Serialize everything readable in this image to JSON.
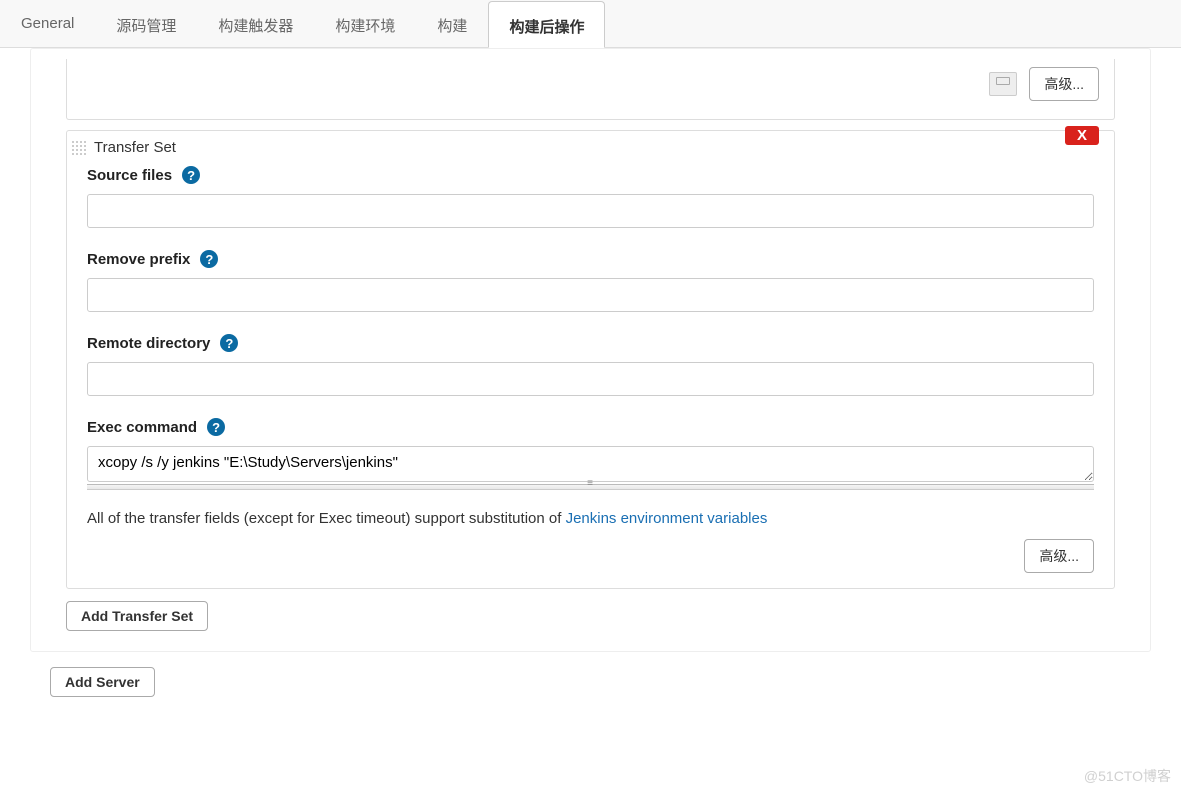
{
  "tabs": [
    {
      "label": "General"
    },
    {
      "label": "源码管理"
    },
    {
      "label": "构建触发器"
    },
    {
      "label": "构建环境"
    },
    {
      "label": "构建"
    },
    {
      "label": "构建后操作",
      "active": true
    }
  ],
  "top_remnant": {
    "button_label": "高级..."
  },
  "transfer_set": {
    "title": "Transfer Set",
    "close_label": "X",
    "fields": {
      "source_files": {
        "label": "Source files",
        "value": ""
      },
      "remove_prefix": {
        "label": "Remove prefix",
        "value": ""
      },
      "remote_directory": {
        "label": "Remote directory",
        "value": ""
      },
      "exec_command": {
        "label": "Exec command",
        "value": "xcopy /s /y jenkins \"E:\\Study\\Servers\\jenkins\""
      }
    },
    "info_prefix": "All of the transfer fields (except for Exec timeout) support substitution of ",
    "info_link": "Jenkins environment variables",
    "advanced_label": "高级..."
  },
  "add_transfer_set_label": "Add Transfer Set",
  "add_server_label": "Add Server",
  "watermark": "@51CTO博客"
}
